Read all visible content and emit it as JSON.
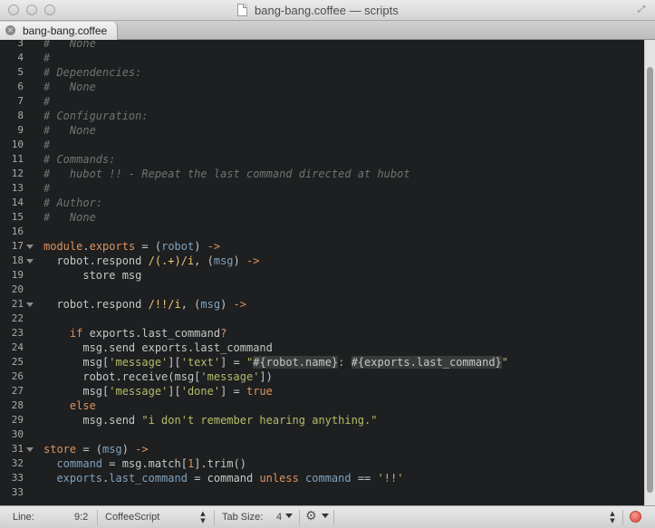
{
  "window": {
    "title": "bang-bang.coffee — scripts"
  },
  "tab": {
    "label": "bang-bang.coffee"
  },
  "editor": {
    "lines": [
      {
        "n": "3",
        "fold": false,
        "parts": [
          [
            "c-com",
            "#   None"
          ]
        ]
      },
      {
        "n": "4",
        "fold": false,
        "parts": [
          [
            "c-com",
            "#"
          ]
        ]
      },
      {
        "n": "5",
        "fold": false,
        "parts": [
          [
            "c-com",
            "# Dependencies:"
          ]
        ]
      },
      {
        "n": "6",
        "fold": false,
        "parts": [
          [
            "c-com",
            "#   None"
          ]
        ]
      },
      {
        "n": "7",
        "fold": false,
        "parts": [
          [
            "c-com",
            "#"
          ]
        ]
      },
      {
        "n": "8",
        "fold": false,
        "parts": [
          [
            "c-com",
            "# Configuration:"
          ]
        ]
      },
      {
        "n": "9",
        "fold": false,
        "parts": [
          [
            "c-com",
            "#   None"
          ]
        ]
      },
      {
        "n": "10",
        "fold": false,
        "parts": [
          [
            "c-com",
            "#"
          ]
        ]
      },
      {
        "n": "11",
        "fold": false,
        "parts": [
          [
            "c-com",
            "# Commands:"
          ]
        ]
      },
      {
        "n": "12",
        "fold": false,
        "parts": [
          [
            "c-com",
            "#   hubot !! - Repeat the last command directed at hubot"
          ]
        ]
      },
      {
        "n": "13",
        "fold": false,
        "parts": [
          [
            "c-com",
            "#"
          ]
        ]
      },
      {
        "n": "14",
        "fold": false,
        "parts": [
          [
            "c-com",
            "# Author:"
          ]
        ]
      },
      {
        "n": "15",
        "fold": false,
        "parts": [
          [
            "c-com",
            "#   None"
          ]
        ]
      },
      {
        "n": "16",
        "fold": false,
        "parts": []
      },
      {
        "n": "17",
        "fold": true,
        "parts": [
          [
            "c-kw",
            "module"
          ],
          [
            "c-def",
            "."
          ],
          [
            "c-kw",
            "exports"
          ],
          [
            "c-def",
            " = "
          ],
          [
            "c-def",
            "("
          ],
          [
            "c-var",
            "robot"
          ],
          [
            "c-def",
            ") "
          ],
          [
            "c-kw",
            "->"
          ]
        ]
      },
      {
        "n": "18",
        "fold": true,
        "parts": [
          [
            "c-def",
            "  robot.respond "
          ],
          [
            "c-rx",
            "/(.+)/i"
          ],
          [
            "c-def",
            ", ("
          ],
          [
            "c-var",
            "msg"
          ],
          [
            "c-def",
            ") "
          ],
          [
            "c-kw",
            "->"
          ]
        ]
      },
      {
        "n": "19",
        "fold": false,
        "parts": [
          [
            "c-def",
            "      store msg"
          ]
        ]
      },
      {
        "n": "20",
        "fold": false,
        "parts": []
      },
      {
        "n": "21",
        "fold": true,
        "parts": [
          [
            "c-def",
            "  robot.respond "
          ],
          [
            "c-rx",
            "/!!/i"
          ],
          [
            "c-def",
            ", ("
          ],
          [
            "c-var",
            "msg"
          ],
          [
            "c-def",
            ") "
          ],
          [
            "c-kw",
            "->"
          ]
        ]
      },
      {
        "n": "22",
        "fold": false,
        "parts": []
      },
      {
        "n": "23",
        "fold": false,
        "parts": [
          [
            "c-kw",
            "    if "
          ],
          [
            "c-def",
            "exports.last_command"
          ],
          [
            "c-kw",
            "?"
          ]
        ]
      },
      {
        "n": "24",
        "fold": false,
        "parts": [
          [
            "c-def",
            "      msg.send exports.last_command"
          ]
        ]
      },
      {
        "n": "25",
        "fold": false,
        "parts": [
          [
            "c-def",
            "      msg["
          ],
          [
            "c-str",
            "'message'"
          ],
          [
            "c-def",
            "]["
          ],
          [
            "c-str",
            "'text'"
          ],
          [
            "c-def",
            "] = "
          ],
          [
            "c-str",
            "\""
          ],
          [
            "c-interp",
            "#{robot.name}"
          ],
          [
            "c-str",
            ": "
          ],
          [
            "c-interp",
            "#{exports.last_command}"
          ],
          [
            "c-str",
            "\""
          ]
        ]
      },
      {
        "n": "26",
        "fold": false,
        "parts": [
          [
            "c-def",
            "      robot.receive(msg["
          ],
          [
            "c-str",
            "'message'"
          ],
          [
            "c-def",
            "])"
          ]
        ]
      },
      {
        "n": "27",
        "fold": false,
        "parts": [
          [
            "c-def",
            "      msg["
          ],
          [
            "c-str",
            "'message'"
          ],
          [
            "c-def",
            "]["
          ],
          [
            "c-str",
            "'done'"
          ],
          [
            "c-def",
            "] = "
          ],
          [
            "c-kw",
            "true"
          ]
        ]
      },
      {
        "n": "28",
        "fold": false,
        "parts": [
          [
            "c-kw",
            "    else"
          ]
        ]
      },
      {
        "n": "29",
        "fold": false,
        "parts": [
          [
            "c-def",
            "      msg.send "
          ],
          [
            "c-str",
            "\"i don't remember hearing anything.\""
          ]
        ]
      },
      {
        "n": "30",
        "fold": false,
        "parts": []
      },
      {
        "n": "31",
        "fold": true,
        "parts": [
          [
            "c-kw",
            "store"
          ],
          [
            "c-def",
            " = ("
          ],
          [
            "c-var",
            "msg"
          ],
          [
            "c-def",
            ") "
          ],
          [
            "c-kw",
            "->"
          ]
        ]
      },
      {
        "n": "32",
        "fold": false,
        "parts": [
          [
            "c-var",
            "  command"
          ],
          [
            "c-def",
            " = msg.match["
          ],
          [
            "c-num",
            "1"
          ],
          [
            "c-def",
            "].trim()"
          ]
        ]
      },
      {
        "n": "33",
        "fold": false,
        "parts": [
          [
            "c-var",
            "  exports"
          ],
          [
            "c-def",
            "."
          ],
          [
            "c-var",
            "last_command"
          ],
          [
            "c-def",
            " = command "
          ],
          [
            "c-kw",
            "unless "
          ],
          [
            "c-var",
            "command"
          ],
          [
            "c-def",
            " == "
          ],
          [
            "c-str",
            "'!!'"
          ]
        ]
      },
      {
        "n": "33",
        "fold": false,
        "parts": []
      }
    ]
  },
  "statusbar": {
    "line_label": "Line:",
    "position": "9:2",
    "syntax": "CoffeeScript",
    "tab_size_label": "Tab Size:",
    "tab_size": "4"
  },
  "colors": {
    "background": "#1d1f21",
    "comment": "#6f7572",
    "keyword": "#de935f",
    "function": "#f0c674",
    "variable": "#81a2be",
    "string": "#b5bd68"
  },
  "icons": [
    "close-icon",
    "minimize-icon",
    "zoom-icon",
    "document-icon",
    "fullscreen-icon",
    "tab-close-icon",
    "gear-icon",
    "record-icon"
  ]
}
